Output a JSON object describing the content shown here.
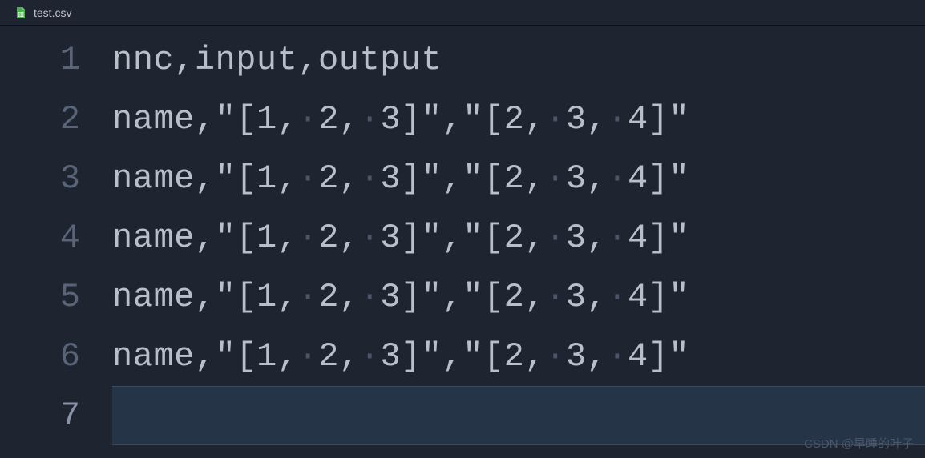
{
  "tab": {
    "filename": "test.csv",
    "icon": "csv-file-icon"
  },
  "editor": {
    "lines": [
      {
        "num": "1",
        "text": "nnc,input,output",
        "current": false
      },
      {
        "num": "2",
        "text": "name,\"[1,·2,·3]\",\"[2,·3,·4]\"",
        "current": false
      },
      {
        "num": "3",
        "text": "name,\"[1,·2,·3]\",\"[2,·3,·4]\"",
        "current": false
      },
      {
        "num": "4",
        "text": "name,\"[1,·2,·3]\",\"[2,·3,·4]\"",
        "current": false
      },
      {
        "num": "5",
        "text": "name,\"[1,·2,·3]\",\"[2,·3,·4]\"",
        "current": false
      },
      {
        "num": "6",
        "text": "name,\"[1,·2,·3]\",\"[2,·3,·4]\"",
        "current": false
      },
      {
        "num": "7",
        "text": "",
        "current": true
      }
    ]
  },
  "watermark": "CSDN @早睡的叶子"
}
